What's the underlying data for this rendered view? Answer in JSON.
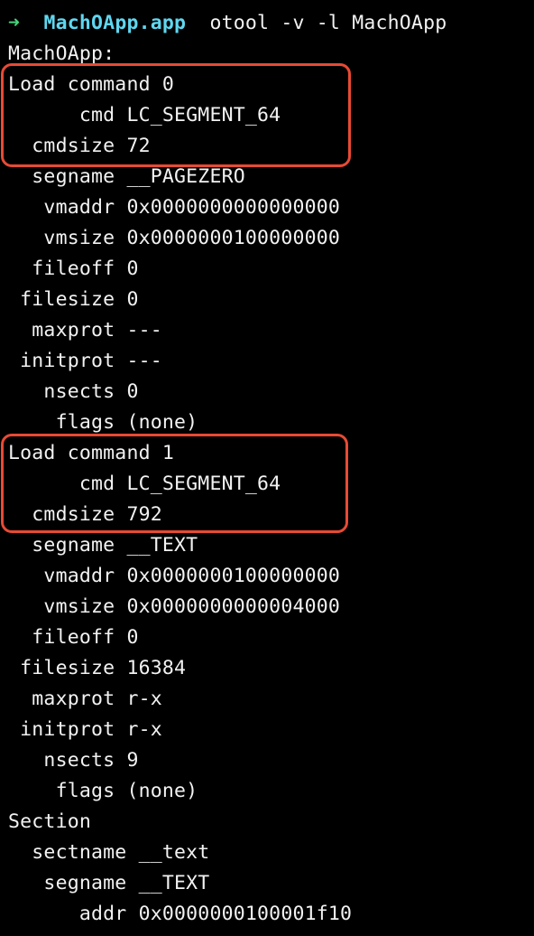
{
  "prompt": {
    "arrow": "➜",
    "directory": "MachOApp.app",
    "command": "otool -v -l MachOApp"
  },
  "highlight_color": "#e84a34",
  "lines": [
    "MachOApp:",
    "Load command 0",
    "      cmd LC_SEGMENT_64",
    "  cmdsize 72",
    "  segname __PAGEZERO",
    "   vmaddr 0x0000000000000000",
    "   vmsize 0x0000000100000000",
    "  fileoff 0",
    " filesize 0",
    "  maxprot ---",
    " initprot ---",
    "   nsects 0",
    "    flags (none)",
    "Load command 1",
    "      cmd LC_SEGMENT_64",
    "  cmdsize 792",
    "  segname __TEXT",
    "   vmaddr 0x0000000100000000",
    "   vmsize 0x0000000000004000",
    "  fileoff 0",
    " filesize 16384",
    "  maxprot r-x",
    " initprot r-x",
    "   nsects 9",
    "    flags (none)",
    "Section",
    "  sectname __text",
    "   segname __TEXT",
    "      addr 0x0000000100001f10"
  ]
}
